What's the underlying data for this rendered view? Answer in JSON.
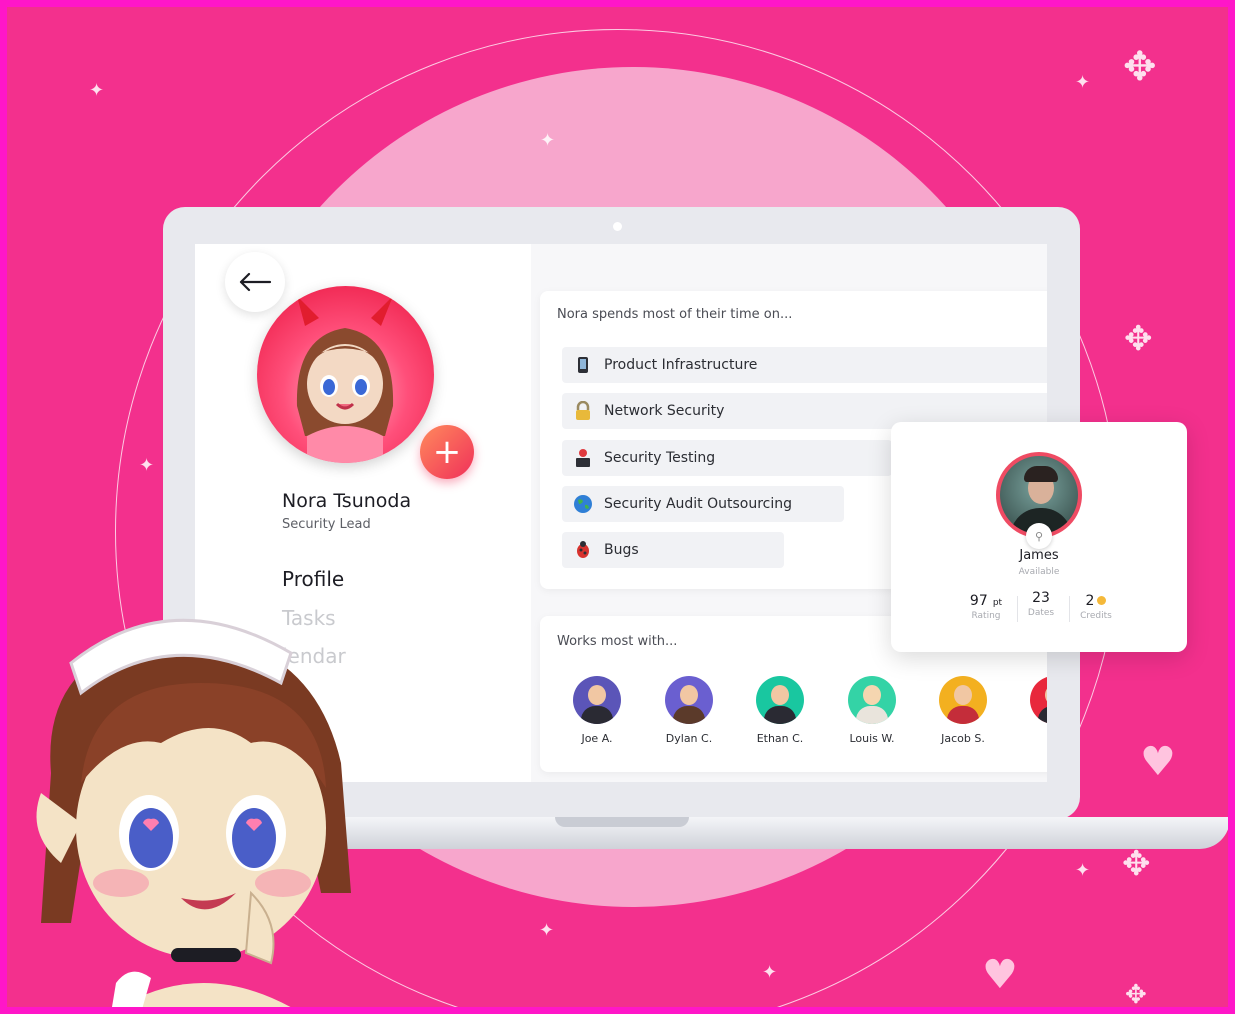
{
  "profile": {
    "name": "Nora Tsunoda",
    "role": "Security Lead",
    "nav": [
      "Profile",
      "Tasks",
      "Calendar"
    ],
    "nav_visible": [
      "Profile",
      "Tasks",
      "lendar"
    ]
  },
  "focus": {
    "title": "Nora spends most of their time on...",
    "topics": [
      {
        "label": "Product Infrastructure",
        "icon": "mobile-phone-icon"
      },
      {
        "label": "Network Security",
        "icon": "lock-icon"
      },
      {
        "label": "Security Testing",
        "icon": "person-at-desk-icon"
      },
      {
        "label": "Security Audit Outsourcing",
        "icon": "globe-icon"
      },
      {
        "label": "Bugs",
        "icon": "bug-icon"
      }
    ]
  },
  "collaborators": {
    "title": "Works most with...",
    "people": [
      {
        "name": "Joe A.",
        "color": "#5b55b8"
      },
      {
        "name": "Dylan C.",
        "color": "#6a5fd0"
      },
      {
        "name": "Ethan C.",
        "color": "#19c7a0"
      },
      {
        "name": "Louis W.",
        "color": "#34d3a6"
      },
      {
        "name": "Jacob S.",
        "color": "#f3b020"
      },
      {
        "name": "Ju",
        "color": "#e8283c"
      }
    ]
  },
  "status_card": {
    "name": "James",
    "status": "Available",
    "rating_value": "97",
    "rating_unit": "pt",
    "rating_label": "Rating",
    "dates_value": "23",
    "dates_label": "Dates",
    "credits_value": "2",
    "credits_label": "Credits"
  },
  "colors": {
    "background": "#f3308d",
    "border": "#ff16c8",
    "disc": "#f7a6cc",
    "accent": "#f0305a"
  }
}
